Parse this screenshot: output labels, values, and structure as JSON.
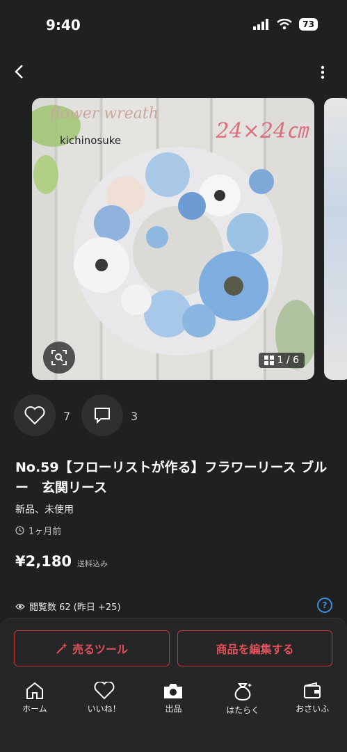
{
  "status_bar": {
    "time": "9:40",
    "battery": "73"
  },
  "photo": {
    "script_text": "flower wreath",
    "size_text": "24×24㎝",
    "watermark": "kichinosuke",
    "counter": "1 / 6"
  },
  "engagement": {
    "likes": "7",
    "comments": "3"
  },
  "item": {
    "title": "No.59【フローリストが作る】フラワーリース ブルー　玄関リース",
    "condition": "新品、未使用",
    "posted": "1ヶ月前",
    "price": "¥2,180",
    "shipping": "送料込み",
    "views": "閲覧数  62 (昨日 +25)"
  },
  "actions": {
    "sell_tool": "売るツール",
    "edit_item": "商品を編集する"
  },
  "tabs": [
    {
      "label": "ホーム",
      "icon": "home-icon"
    },
    {
      "label": "いいね！",
      "icon": "heart-icon"
    },
    {
      "label": "出品",
      "icon": "camera-icon"
    },
    {
      "label": "はたらく",
      "icon": "money-bag-icon"
    },
    {
      "label": "おさいふ",
      "icon": "wallet-icon"
    }
  ],
  "colors": {
    "accent": "#c8333e",
    "help": "#3b8fe0",
    "background": "#202020"
  }
}
